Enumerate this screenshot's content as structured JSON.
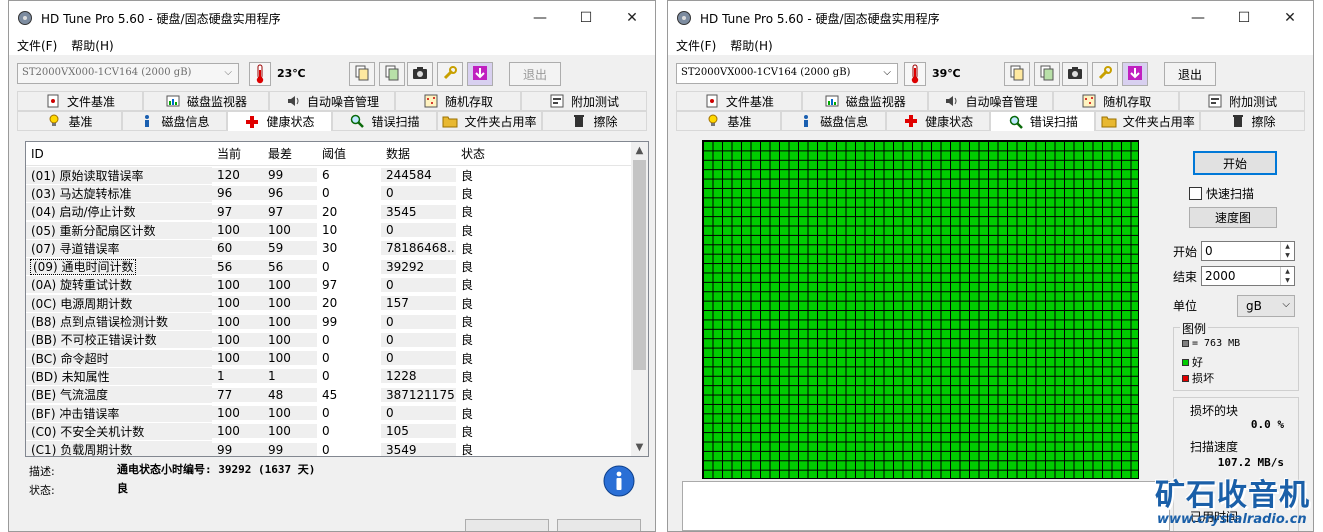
{
  "app": {
    "title": "HD Tune Pro 5.60 - 硬盘/固态硬盘实用程序",
    "menu": [
      "文件(F)",
      "帮助(H)"
    ],
    "caption": {
      "minimize": "—",
      "maximize": "☐",
      "close": "✕"
    }
  },
  "left": {
    "drive": "ST2000VX000-1CV164 (2000 gB)",
    "temperature": "23℃",
    "exit_label": "退出",
    "tabs_row1": [
      "文件基准",
      "磁盘监视器",
      "自动噪音管理",
      "随机存取",
      "附加测试"
    ],
    "tabs_row2": [
      "基准",
      "磁盘信息",
      "健康状态",
      "错误扫描",
      "文件夹占用率",
      "擦除"
    ],
    "selected_tab": "健康状态",
    "columns": [
      "ID",
      "当前",
      "最差",
      "阈值",
      "数据",
      "状态"
    ],
    "rows": [
      [
        "(01) 原始读取错误率",
        "120",
        "99",
        "6",
        "244584",
        "良"
      ],
      [
        "(03) 马达旋转标准",
        "96",
        "96",
        "0",
        "0",
        "良"
      ],
      [
        "(04) 启动/停止计数",
        "97",
        "97",
        "20",
        "3545",
        "良"
      ],
      [
        "(05) 重新分配扇区计数",
        "100",
        "100",
        "10",
        "0",
        "良"
      ],
      [
        "(07) 寻道错误率",
        "60",
        "59",
        "30",
        "78186468...",
        "良"
      ],
      [
        "(09) 通电时间计数",
        "56",
        "56",
        "0",
        "39292",
        "良"
      ],
      [
        "(0A) 旋转重试计数",
        "100",
        "100",
        "97",
        "0",
        "良"
      ],
      [
        "(0C) 电源周期计数",
        "100",
        "100",
        "20",
        "157",
        "良"
      ],
      [
        "(B8) 点到点错误检测计数",
        "100",
        "100",
        "99",
        "0",
        "良"
      ],
      [
        "(BB) 不可校正错误计数",
        "100",
        "100",
        "0",
        "0",
        "良"
      ],
      [
        "(BC) 命令超时",
        "100",
        "100",
        "0",
        "0",
        "良"
      ],
      [
        "(BD) 未知属性",
        "1",
        "1",
        "0",
        "1228",
        "良"
      ],
      [
        "(BE) 气流温度",
        "77",
        "48",
        "45",
        "387121175",
        "良"
      ],
      [
        "(BF) 冲击错误率",
        "100",
        "100",
        "0",
        "0",
        "良"
      ],
      [
        "(C0) 不安全关机计数",
        "100",
        "100",
        "0",
        "105",
        "良"
      ],
      [
        "(C1) 负载周期计数",
        "99",
        "99",
        "0",
        "3549",
        "良"
      ]
    ],
    "desc_label": "描述:",
    "desc_value": "通电状态小时编号: 39292 (1637 天)",
    "status_label": "状态:",
    "status_value": "良"
  },
  "right": {
    "drive": "ST2000VX000-1CV164 (2000 gB)",
    "temperature": "39℃",
    "exit_label": "退出",
    "selected_tab": "错误扫描",
    "start_button": "开始",
    "quick_scan": "快速扫描",
    "speed_map": "速度图",
    "start_label": "开始",
    "start_value": "0",
    "end_label": "结束",
    "end_value": "2000",
    "unit_label": "单位",
    "unit_value": "gB",
    "legend_title": "图例",
    "legend_block": "= 763 MB",
    "legend_good": "好",
    "legend_bad": "损坏",
    "damaged_label": "损坏的块",
    "damaged_value": "0.0 %",
    "speed_label": "扫描速度",
    "speed_value": "107.2 MB/s",
    "truncated_label": "已用时间"
  },
  "colors": {
    "good": "#00cc00",
    "bad": "#e00000",
    "block": "#808080",
    "accent": "#0078d7"
  },
  "watermark": {
    "text": "矿石收音机",
    "url": "www.crystalradio.cn"
  }
}
